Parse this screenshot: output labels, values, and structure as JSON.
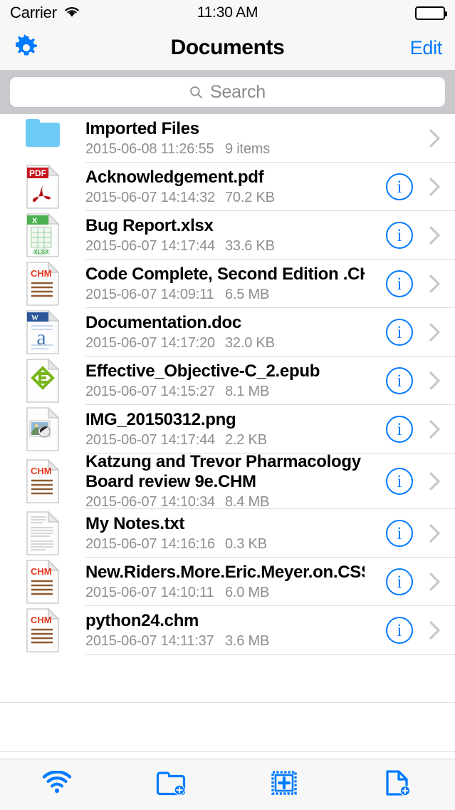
{
  "status_bar": {
    "carrier": "Carrier",
    "wifi_icon": "wifi-icon",
    "time": "11:30 AM",
    "battery_icon": "battery-full-icon"
  },
  "nav_bar": {
    "settings_icon": "gear-icon",
    "title": "Documents",
    "edit_label": "Edit"
  },
  "search": {
    "icon": "search-icon",
    "placeholder": "Search",
    "value": ""
  },
  "colors": {
    "accent_blue": "#007aff",
    "folder_blue": "#6ecbf5",
    "separator": "#dcdcdc",
    "meta_gray": "#8e8e93",
    "chrome_bg": "#f7f7f7",
    "search_bg": "#c8c8cd",
    "pdf_red": "#c8161d",
    "xlsx_green": "#4caf50",
    "doc_blue": "#2b579a",
    "chm_red": "#e8381f",
    "epub_green": "#79b51c"
  },
  "files": [
    {
      "name": "Imported Files",
      "date": "2015-06-08 11:26:55",
      "size": "9 items",
      "kind": "folder",
      "icon": "folder-icon",
      "has_info": false
    },
    {
      "name": "Acknowledgement.pdf",
      "date": "2015-06-07 14:14:32",
      "size": "70.2 KB",
      "kind": "pdf",
      "icon": "pdf-file-icon",
      "has_info": true
    },
    {
      "name": "Bug Report.xlsx",
      "date": "2015-06-07 14:17:44",
      "size": "33.6 KB",
      "kind": "xlsx",
      "icon": "xlsx-file-icon",
      "has_info": true
    },
    {
      "name": "Code Complete, Second Edition .CHM",
      "date": "2015-06-07 14:09:11",
      "size": "6.5 MB",
      "kind": "chm",
      "icon": "chm-file-icon",
      "has_info": true
    },
    {
      "name": "Documentation.doc",
      "date": "2015-06-07 14:17:20",
      "size": "32.0 KB",
      "kind": "doc",
      "icon": "doc-file-icon",
      "has_info": true
    },
    {
      "name": "Effective_Objective-C_2.epub",
      "date": "2015-06-07 14:15:27",
      "size": "8.1 MB",
      "kind": "epub",
      "icon": "epub-file-icon",
      "has_info": true
    },
    {
      "name": "IMG_20150312.png",
      "date": "2015-06-07 14:17:44",
      "size": "2.2 KB",
      "kind": "png",
      "icon": "image-file-icon",
      "has_info": true
    },
    {
      "name": "Katzung and Trevor Pharmacology Board review 9e.CHM",
      "date": "2015-06-07 14:10:34",
      "size": "8.4 MB",
      "kind": "chm",
      "icon": "chm-file-icon",
      "has_info": true
    },
    {
      "name": "My Notes.txt",
      "date": "2015-06-07 14:16:16",
      "size": "0.3 KB",
      "kind": "txt",
      "icon": "txt-file-icon",
      "has_info": true
    },
    {
      "name": "New.Riders.More.Eric.Meyer.on.CSS.chm",
      "date": "2015-06-07 14:10:11",
      "size": "6.0 MB",
      "kind": "chm",
      "icon": "chm-file-icon",
      "has_info": true
    },
    {
      "name": "python24.chm",
      "date": "2015-06-07 14:11:37",
      "size": "3.6 MB",
      "kind": "chm",
      "icon": "chm-file-icon",
      "has_info": true
    }
  ],
  "row_accessory": {
    "info_label": "i",
    "chevron_icon": "chevron-right-icon"
  },
  "toolbar": [
    {
      "icon": "wifi-transfer-icon",
      "label": ""
    },
    {
      "icon": "new-folder-icon",
      "label": ""
    },
    {
      "icon": "add-photo-icon",
      "label": ""
    },
    {
      "icon": "new-file-icon",
      "label": ""
    }
  ]
}
